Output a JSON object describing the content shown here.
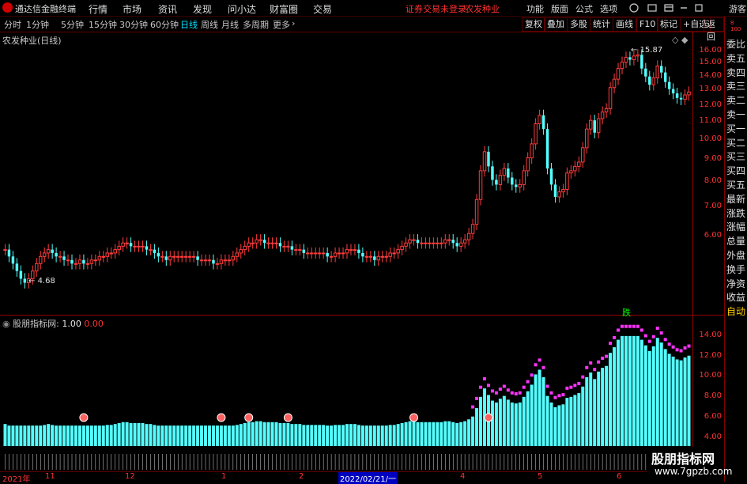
{
  "app": {
    "title": "通达信金融终端"
  },
  "menu": [
    "行情",
    "市场",
    "资讯",
    "发现",
    "问小达",
    "财富圈",
    "交易"
  ],
  "status_text": "证券交易未登录",
  "stock_name_top": "农发种业",
  "right_tools": [
    "功能",
    "版面",
    "公式",
    "选项"
  ],
  "user_label": "游客",
  "periods": [
    "分时",
    "1分钟",
    "5分钟",
    "15分钟",
    "30分钟",
    "60分钟",
    "日线",
    "周线",
    "月线",
    "多周期",
    "更多"
  ],
  "active_period": "日线",
  "period_more_icon": "chevron-right-icon",
  "chart_buttons": [
    "复权",
    "叠加",
    "多股",
    "统计",
    "画线",
    "F10",
    "标记",
    "+自选",
    "返回"
  ],
  "sidebar": [
    "委比",
    "卖五",
    "卖四",
    "卖三",
    "卖二",
    "卖一",
    "买一",
    "买二",
    "买三",
    "买四",
    "买五",
    "最新",
    "涨跌",
    "涨幅",
    "总量",
    "外盘",
    "换手",
    "净资",
    "收益"
  ],
  "sidebar_auto": "自动",
  "chart_title": "农发种业(日线)",
  "indicator": {
    "name": "股朋指标网",
    "sep": ":",
    "v1": "1.00",
    "v2": "0.00"
  },
  "annotations": {
    "high": "15.87",
    "low": "4.68",
    "signal": "跌"
  },
  "date_labels": [
    "2021年",
    "11",
    "12",
    "1",
    "2",
    "2022/02/21/一",
    "4",
    "5",
    "6"
  ],
  "watermark": {
    "cn": "股朋指标网",
    "url": "www.7gpzb.com"
  },
  "colors": {
    "up": "#ff3c3c",
    "down": "#54ffff",
    "accent": "#00e0ff",
    "pink": "#ff33ff",
    "green": "#00ff00"
  },
  "chart_data": [
    {
      "type": "candlestick",
      "title": "农发种业(日线)",
      "y_ticks": [
        "16.00",
        "15.00",
        "14.00",
        "13.00",
        "12.00",
        "11.00",
        "10.00",
        "9.00",
        "8.00",
        "7.00",
        "6.00"
      ],
      "ylim": [
        4.0,
        16.6
      ],
      "scale": "log",
      "series_close_estimates": [
        5.6,
        5.4,
        5.2,
        5.0,
        4.8,
        4.7,
        4.8,
        5.0,
        5.2,
        5.4,
        5.5,
        5.6,
        5.5,
        5.4,
        5.4,
        5.3,
        5.3,
        5.2,
        5.2,
        5.3,
        5.2,
        5.2,
        5.3,
        5.3,
        5.4,
        5.4,
        5.5,
        5.5,
        5.6,
        5.7,
        5.8,
        5.8,
        5.7,
        5.7,
        5.7,
        5.7,
        5.6,
        5.6,
        5.5,
        5.4,
        5.4,
        5.3,
        5.4,
        5.4,
        5.4,
        5.4,
        5.4,
        5.4,
        5.4,
        5.3,
        5.3,
        5.3,
        5.3,
        5.2,
        5.2,
        5.3,
        5.3,
        5.3,
        5.4,
        5.5,
        5.6,
        5.7,
        5.8,
        5.8,
        5.9,
        5.9,
        5.8,
        5.8,
        5.8,
        5.8,
        5.7,
        5.7,
        5.7,
        5.6,
        5.6,
        5.6,
        5.5,
        5.5,
        5.5,
        5.5,
        5.5,
        5.5,
        5.4,
        5.4,
        5.5,
        5.5,
        5.5,
        5.6,
        5.6,
        5.6,
        5.5,
        5.4,
        5.4,
        5.4,
        5.3,
        5.4,
        5.4,
        5.4,
        5.5,
        5.5,
        5.6,
        5.7,
        5.8,
        5.9,
        5.9,
        5.8,
        5.8,
        5.8,
        5.8,
        5.8,
        5.8,
        5.8,
        5.9,
        5.9,
        5.8,
        5.7,
        5.8,
        5.9,
        6.1,
        6.4,
        7.3,
        8.5,
        9.4,
        8.7,
        8.1,
        7.9,
        8.3,
        8.6,
        8.2,
        7.9,
        7.8,
        7.9,
        8.5,
        9.1,
        9.8,
        10.9,
        11.4,
        10.6,
        8.6,
        7.9,
        7.4,
        7.6,
        7.7,
        8.4,
        8.5,
        8.7,
        8.9,
        9.6,
        10.6,
        11.1,
        10.4,
        11.2,
        11.6,
        11.8,
        13.2,
        13.8,
        14.6,
        15.1,
        15.5,
        15.3,
        15.6,
        15.7,
        14.6,
        14.0,
        13.4,
        13.9,
        14.8,
        14.3,
        13.6,
        13.1,
        12.8,
        12.5,
        12.4,
        12.7,
        12.9
      ]
    },
    {
      "type": "bar",
      "title": "股朋指标网",
      "y_ticks": [
        "14.00",
        "12.00",
        "10.00",
        "8.00",
        "6.00",
        "4.00"
      ],
      "ylim": [
        3.5,
        15.0
      ]
    }
  ]
}
